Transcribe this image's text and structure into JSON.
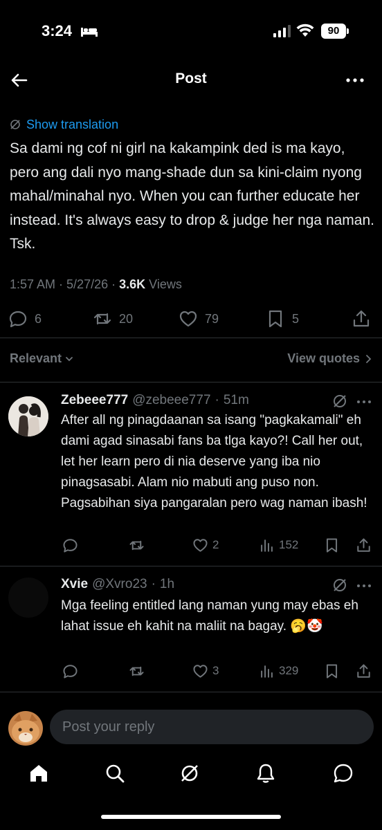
{
  "status_bar": {
    "time": "3:24",
    "battery": "90"
  },
  "header": {
    "title": "Post"
  },
  "post": {
    "translate_label": "Show translation",
    "text": "Sa dami ng cof ni girl na kakampink ded is ma kayo, pero ang dali nyo mang-shade dun sa kini-claim nyong mahal/minahal nyo. When you can further educate her instead. It's always easy to drop & judge her nga naman. Tsk.",
    "time": "1:57 AM",
    "date": "5/27/26",
    "views_count": "3.6K",
    "views_label": "Views",
    "stats": {
      "replies": "6",
      "reposts": "20",
      "likes": "79",
      "bookmarks": "5"
    }
  },
  "sort": {
    "relevant_label": "Relevant",
    "view_quotes_label": "View quotes"
  },
  "replies": [
    {
      "name": "Zebeee777",
      "handle": "@zebeee777",
      "time": "51m",
      "text": "After all ng pinagdaanan sa isang \"pagkakamali\" eh dami agad sinasabi fans ba tlga kayo?! Call her out, let her learn pero di nia deserve yang iba nio pinagsasabi. Alam nio mabuti ang puso non. Pagsabihan siya pangaralan pero wag naman ibash!",
      "likes": "2",
      "views": "152"
    },
    {
      "name": "Xvie",
      "handle": "@Xvro23",
      "time": "1h",
      "text": "Mga feeling entitled lang naman yung may ebas eh lahat issue eh kahit na maliit na bagay.",
      "emojis": "🥱🤡",
      "likes": "3",
      "views": "329"
    }
  ],
  "compose": {
    "placeholder": "Post your reply"
  },
  "colors": {
    "background": "#000000",
    "text": "#e7e9ea",
    "muted": "#71767b",
    "accent": "#1d9bf0",
    "divider": "#2f3336"
  },
  "icons": [
    "bed-icon",
    "signal-icon",
    "wifi-icon",
    "back-arrow-icon",
    "more-icon",
    "grok-icon",
    "reply-icon",
    "repost-icon",
    "like-icon",
    "bookmark-icon",
    "share-icon",
    "views-icon",
    "home-icon",
    "search-icon",
    "notifications-icon",
    "messages-icon"
  ]
}
